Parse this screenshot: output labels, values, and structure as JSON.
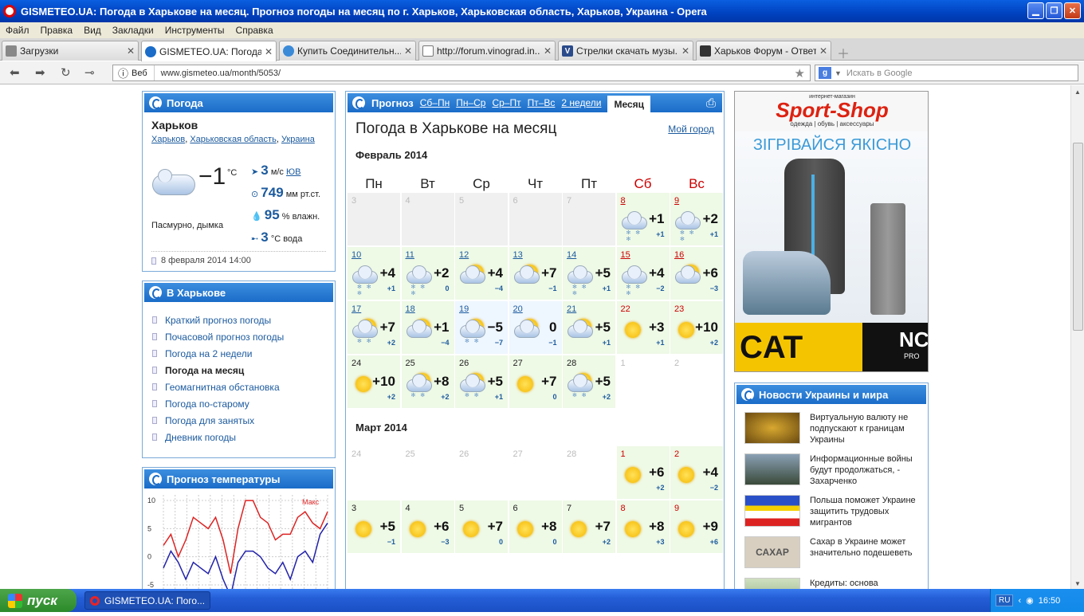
{
  "window": {
    "title": "GISMETEO.UA: Погода в Харькове на месяц. Прогноз погоды на месяц по г. Харьков, Харьковская область, Харьков, Украина - Opera"
  },
  "menu": [
    "Файл",
    "Правка",
    "Вид",
    "Закладки",
    "Инструменты",
    "Справка"
  ],
  "tabs": [
    {
      "label": "Загрузки",
      "active": false
    },
    {
      "label": "GISMETEO.UA: Погода ...",
      "active": true
    },
    {
      "label": "Купить Соединительн...",
      "active": false
    },
    {
      "label": "http://forum.vinograd.in...",
      "active": false
    },
    {
      "label": "Стрелки скачать музы...",
      "active": false
    },
    {
      "label": "Харьков Форум - Ответ...",
      "active": false
    }
  ],
  "address": {
    "web_label": "Веб",
    "url": "www.gismeteo.ua/month/5053/",
    "search_placeholder": "Искать в Google"
  },
  "weather": {
    "title": "Погода",
    "city": "Харьков",
    "loc1": "Харьков",
    "loc2": "Харьковская область",
    "loc3": "Украина",
    "temp": "−1",
    "unit": "°C",
    "wind_val": "3",
    "wind_unit": "м/с",
    "wind_dir": "ЮВ",
    "press_val": "749",
    "press_unit": "мм рт.ст.",
    "hum_val": "95",
    "hum_unit": "% влажн.",
    "water_val": "3",
    "water_unit": "°C вода",
    "desc": "Пасмурно, дымка",
    "date": "8 февраля 2014 14:00"
  },
  "city_panel": {
    "title": "В Харькове",
    "links": [
      "Краткий прогноз погоды",
      "Почасовой прогноз погоды",
      "Погода на 2 недели",
      "Погода на месяц",
      "Геомагнитная обстановка",
      "Погода по-старому",
      "Погода для занятых",
      "Дневник погоды"
    ]
  },
  "temp_panel": {
    "title": "Прогноз температуры",
    "legend": "Макс",
    "yticks": [
      "10",
      "5",
      "0",
      "-5"
    ]
  },
  "chart_data": {
    "type": "line",
    "title": "Прогноз температуры",
    "yticks": [
      10,
      5,
      0,
      -5
    ],
    "ylim": [
      -6,
      11
    ],
    "series": [
      {
        "name": "Макс",
        "color": "#d22",
        "values": [
          2,
          4,
          0,
          3,
          7,
          6,
          5,
          7,
          3,
          -3,
          5,
          10,
          10,
          7,
          6,
          3,
          4,
          4,
          7,
          8,
          6,
          5,
          8
        ]
      },
      {
        "name": "",
        "color": "#22a",
        "values": [
          -2,
          1,
          -1,
          -4,
          -1,
          -2,
          -3,
          0,
          -4,
          -7,
          -1,
          1,
          1,
          0,
          -2,
          -3,
          -1,
          -4,
          0,
          1,
          -1,
          4,
          6
        ]
      }
    ]
  },
  "main": {
    "prognoz": "Прогноз",
    "hlinks": [
      "Сб–Пн",
      "Пн–Ср",
      "Ср–Пт",
      "Пт–Вс",
      "2 недели"
    ],
    "active": "Месяц",
    "page_title": "Погода в Харькове на месяц",
    "my_city": "Мой город",
    "days": [
      "Пн",
      "Вт",
      "Ср",
      "Чт",
      "Пт",
      "Сб",
      "Вс"
    ],
    "feb_title": "Февраль 2014",
    "mar_title": "Март 2014",
    "feb": [
      {
        "d": "3"
      },
      {
        "d": "4"
      },
      {
        "d": "5"
      },
      {
        "d": "6"
      },
      {
        "d": "7"
      },
      {
        "d": "8",
        "t": "+1",
        "n": "+1",
        "i": "cs",
        "h": "red",
        "bg": "w"
      },
      {
        "d": "9",
        "t": "+2",
        "n": "+1",
        "i": "cs",
        "h": "red",
        "bg": "w"
      },
      {
        "d": "10",
        "t": "+4",
        "n": "+1",
        "i": "cs",
        "bg": "w"
      },
      {
        "d": "11",
        "t": "+2",
        "n": "0",
        "i": "cs",
        "bg": "w"
      },
      {
        "d": "12",
        "t": "+4",
        "n": "−4",
        "i": "sc",
        "bg": "w"
      },
      {
        "d": "13",
        "t": "+7",
        "n": "−1",
        "i": "sc",
        "bg": "w"
      },
      {
        "d": "14",
        "t": "+5",
        "n": "+1",
        "i": "cs",
        "bg": "w"
      },
      {
        "d": "15",
        "t": "+4",
        "n": "−2",
        "i": "cs",
        "h": "red",
        "bg": "w"
      },
      {
        "d": "16",
        "t": "+6",
        "n": "−3",
        "i": "sc",
        "h": "red",
        "bg": "w"
      },
      {
        "d": "17",
        "t": "+7",
        "n": "+2",
        "i": "scs",
        "bg": "w"
      },
      {
        "d": "18",
        "t": "+1",
        "n": "−4",
        "i": "sc",
        "bg": "w"
      },
      {
        "d": "19",
        "t": "−5",
        "n": "−7",
        "i": "scs",
        "bg": "b"
      },
      {
        "d": "20",
        "t": "0",
        "n": "−1",
        "i": "sc",
        "bg": "b"
      },
      {
        "d": "21",
        "t": "+5",
        "n": "+1",
        "i": "sc",
        "bg": "w"
      },
      {
        "d": "22",
        "t": "+3",
        "n": "+1",
        "i": "s",
        "h": "redp",
        "bg": "w"
      },
      {
        "d": "23",
        "t": "+10",
        "n": "+2",
        "i": "s",
        "h": "redp",
        "bg": "w"
      },
      {
        "d": "24",
        "t": "+10",
        "n": "+2",
        "i": "s",
        "h": "plain",
        "bg": "w"
      },
      {
        "d": "25",
        "t": "+8",
        "n": "+2",
        "i": "scs",
        "h": "plain",
        "bg": "w"
      },
      {
        "d": "26",
        "t": "+5",
        "n": "+1",
        "i": "scs",
        "h": "plain",
        "bg": "w"
      },
      {
        "d": "27",
        "t": "+7",
        "n": "0",
        "i": "s",
        "h": "plain",
        "bg": "w"
      },
      {
        "d": "28",
        "t": "+5",
        "n": "+2",
        "i": "scs",
        "h": "plain",
        "bg": "w"
      },
      {
        "d": "1",
        "blank": true
      },
      {
        "d": "2",
        "blank": true
      }
    ],
    "mar": [
      {
        "d": "24",
        "blank": true
      },
      {
        "d": "25",
        "blank": true
      },
      {
        "d": "26",
        "blank": true
      },
      {
        "d": "27",
        "blank": true
      },
      {
        "d": "28",
        "blank": true
      },
      {
        "d": "1",
        "t": "+6",
        "n": "+2",
        "i": "s",
        "h": "redp",
        "bg": "w"
      },
      {
        "d": "2",
        "t": "+4",
        "n": "−2",
        "i": "s",
        "h": "redp",
        "bg": "w"
      },
      {
        "d": "3",
        "t": "+5",
        "n": "−1",
        "i": "s",
        "h": "plain",
        "bg": "w"
      },
      {
        "d": "4",
        "t": "+6",
        "n": "−3",
        "i": "s",
        "h": "plain",
        "bg": "w"
      },
      {
        "d": "5",
        "t": "+7",
        "n": "0",
        "i": "s",
        "h": "plain",
        "bg": "w"
      },
      {
        "d": "6",
        "t": "+8",
        "n": "0",
        "i": "s",
        "h": "plain",
        "bg": "w"
      },
      {
        "d": "7",
        "t": "+7",
        "n": "+2",
        "i": "s",
        "h": "plain",
        "bg": "w"
      },
      {
        "d": "8",
        "t": "+8",
        "n": "+3",
        "i": "s",
        "h": "redp",
        "bg": "w"
      },
      {
        "d": "9",
        "t": "+9",
        "n": "+6",
        "i": "s",
        "h": "redp",
        "bg": "w"
      }
    ]
  },
  "ad": {
    "top": "интернет-магазин",
    "brand": "Sport-Shop",
    "sub": "одежда | обувь | аксессуары",
    "slogan": "ЗІГРІВАЙСЯ ЯКІСНО",
    "cat": "CAT",
    "nc": "NC",
    "pro": "PRO"
  },
  "news": {
    "title": "Новости Украины и мира",
    "items": [
      "Виртуальную валюту не подпускают к границам Украины",
      "Информационные войны будут продолжаться, - Захарченко",
      "Польша поможет Украине защитить трудовых мигрантов",
      "Сахар в Украине может значительно подешеветь",
      "Кредиты: основа"
    ],
    "thumb4_text": "САХАР"
  },
  "taskbar": {
    "start": "пуск",
    "item": "GISMETEO.UA: Пого...",
    "lang": "RU",
    "time": "16:50"
  }
}
